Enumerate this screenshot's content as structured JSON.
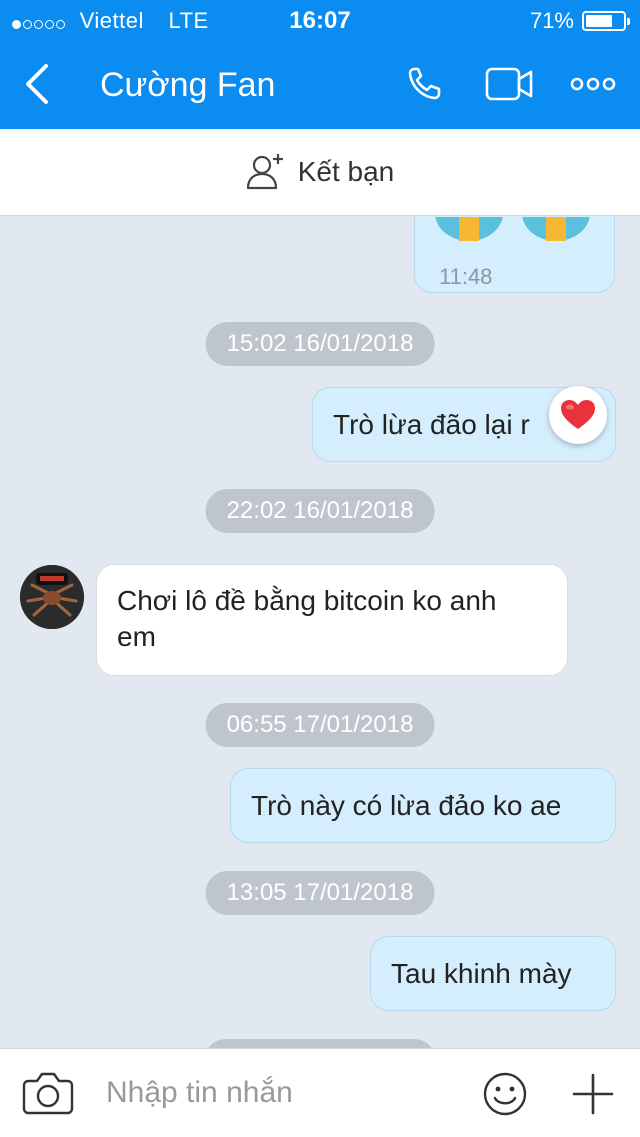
{
  "status_bar": {
    "carrier": "Viettel",
    "network": "LTE",
    "time": "16:07",
    "battery_percent": "71%",
    "battery_level": 0.71
  },
  "header": {
    "title": "Cường Fan",
    "icons": [
      "back-icon",
      "phone-icon",
      "video-call-icon",
      "more-icon"
    ]
  },
  "friend_bar": {
    "label": "Kết bạn",
    "icon": "add-friend-icon"
  },
  "messages": {
    "m0": {
      "time": "11:48"
    },
    "t1": "15:02 16/01/2018",
    "m1": {
      "text": "Trò lừa đão lại r",
      "reaction": "heart"
    },
    "t2": "22:02 16/01/2018",
    "m2": {
      "line1": "Chơi lô đề bằng bitcoin ko anh",
      "line2": "em"
    },
    "t3": "06:55 17/01/2018",
    "m3": {
      "text": "Trò này có lừa đảo ko ae"
    },
    "t4": "13:05 17/01/2018",
    "m4": {
      "text": "Tau khinh mày"
    }
  },
  "input_bar": {
    "placeholder": "Nhập tin nhắn",
    "icons": [
      "camera-icon",
      "emoji-icon",
      "plus-icon"
    ]
  },
  "colors": {
    "header_bg": "#0a8cf0",
    "chat_bg": "#e2e8ef",
    "outgoing_bubble": "#d5eefd",
    "incoming_bubble": "#ffffff",
    "time_pill": "#bfc5cc"
  }
}
